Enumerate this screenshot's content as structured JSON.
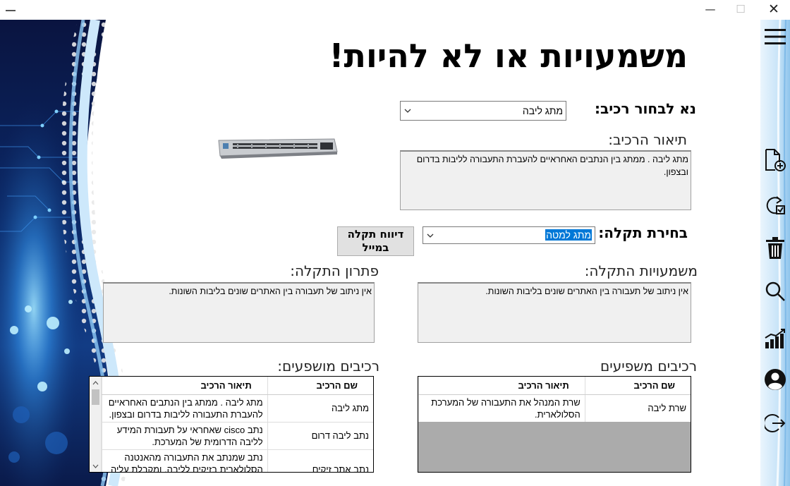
{
  "window": {
    "minimize_glyph": "—",
    "maximize_glyph": "☐",
    "close_glyph": "✕"
  },
  "page": {
    "title": "משמעויות או לא להיות!"
  },
  "component_select": {
    "label": "נא לבחור רכיב:",
    "value": "מתג ליבה"
  },
  "component_description": {
    "label": "תיאור הרכיב:",
    "text": "מתג ליבה . ממתג בין הנתבים האחראיים להעברת התעבורה לליבות בדרום ובצפון."
  },
  "fault_select": {
    "label": "בחירת תקלה:",
    "value": "מתג למטה"
  },
  "report_button": {
    "label": "דיווח תקלה במייל"
  },
  "fault_meaning": {
    "label": "משמעויות התקלה:",
    "text": "אין ניתוב של תעבורה בין האתרים שונים בליבות השונות."
  },
  "fault_solution": {
    "label": "פתרון התקלה:",
    "text": "אין ניתוב של תעבורה בין האתרים שונים בליבות השונות."
  },
  "affecting_components": {
    "label": "רכיבים משפיעים",
    "columns": [
      "שם הרכיב",
      "תיאור הרכיב"
    ],
    "rows": [
      [
        "שרת ליבה",
        "שרת המנהל את התעבורה של המערכת הסלולארית."
      ]
    ]
  },
  "affected_components": {
    "label": "רכיבים מושפעים:",
    "columns": [
      "שם הרכיב",
      "תיאור הרכיב"
    ],
    "rows": [
      [
        "מתג ליבה",
        "מתג ליבה . ממתג בין הנתבים האחראיים להעברת התעבורה לליבות בדרום ובצפון."
      ],
      [
        "נתב ליבה דרום",
        "נתב cisco שאחראי על תעבורת המידע לליבה הדרומית של המערכת."
      ],
      [
        "נתב אתר זיקים",
        "נתב שמנתב את התעבורה מהאנטנה הסלולארית בזיקים לליבה, ומקבלת עליה"
      ]
    ]
  },
  "sidebar": {
    "icons": [
      "menu-icon",
      "add-file-icon",
      "refresh-check-icon",
      "trash-icon",
      "search-icon",
      "chart-icon",
      "user-icon",
      "logout-icon"
    ]
  },
  "colors": {
    "selection_highlight": "#0078d7",
    "grid_empty": "#ababab",
    "textbox_bg": "#f0f0f0",
    "art_dark": "#0b1b46",
    "art_light": "#2f8fe8"
  }
}
